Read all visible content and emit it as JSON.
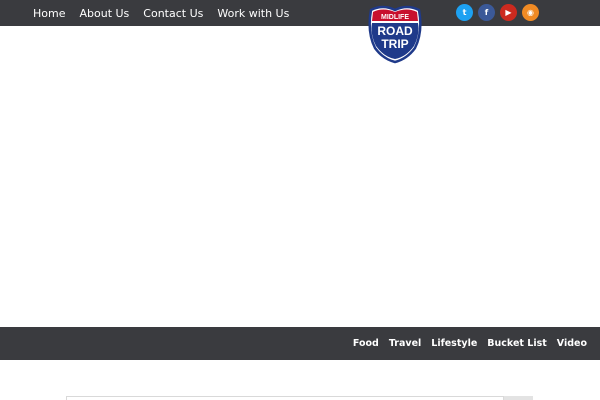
{
  "top_nav": {
    "items": [
      "Home",
      "About Us",
      "Contact Us",
      "Work with Us"
    ]
  },
  "logo": {
    "line1": "MIDLIFE",
    "line2": "ROAD",
    "line3": "TRIP"
  },
  "social": {
    "twitter": "t",
    "facebook": "f",
    "youtube": "▶",
    "rss": "◉"
  },
  "category_nav": {
    "items": [
      "Food",
      "Travel",
      "Lifestyle",
      "Bucket List",
      "Video"
    ]
  },
  "colors": {
    "bar_background": "#3a3b3f",
    "twitter": "#1da1f2",
    "facebook": "#3b5998",
    "youtube": "#cc2a1f",
    "rss": "#f08a24",
    "logo_blue": "#1f3a8a",
    "logo_red": "#c8102e"
  }
}
